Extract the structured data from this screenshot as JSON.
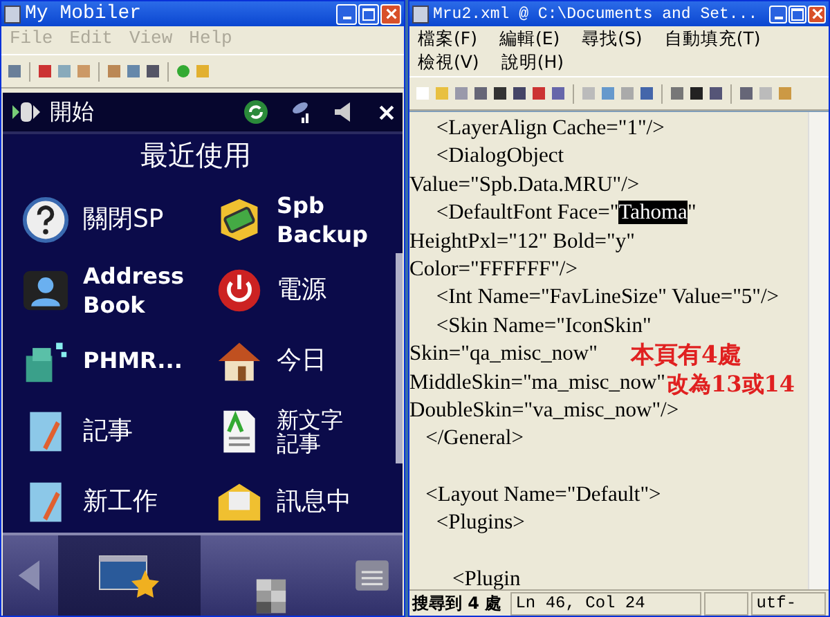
{
  "left_window": {
    "title": "My Mobiler",
    "menu": [
      "File",
      "Edit",
      "View",
      "Help"
    ],
    "device": {
      "start_label": "開始",
      "section_title": "最近使用",
      "apps": [
        {
          "label": "關閉SP",
          "kind": "help"
        },
        {
          "label": "Spb Backup",
          "kind": "backup"
        },
        {
          "label": "Address Book",
          "kind": "contact"
        },
        {
          "label": "電源",
          "kind": "power"
        },
        {
          "label": "PHMR...",
          "kind": "registry"
        },
        {
          "label": "今日",
          "kind": "home"
        },
        {
          "label": "記事",
          "kind": "notes"
        },
        {
          "label": "新文字記事",
          "kind": "document"
        },
        {
          "label": "新工作",
          "kind": "task"
        },
        {
          "label": "訊息中",
          "kind": "message"
        }
      ],
      "nav": [
        {
          "kind": "back",
          "selected": false
        },
        {
          "kind": "favorites",
          "selected": true
        },
        {
          "kind": "grid",
          "selected": false
        },
        {
          "kind": "menu",
          "selected": false
        }
      ]
    }
  },
  "right_window": {
    "title": "Mru2.xml @ C:\\Documents and Set...",
    "menu": [
      "檔案(F)",
      "編輯(E)",
      "尋找(S)",
      "自動填充(T)",
      "檢視(V)",
      "說明(H)"
    ],
    "lines": [
      {
        "segments": [
          {
            "text": "     <LayerAlign Cache=\"1\"/>",
            "selected": false
          }
        ]
      },
      {
        "segments": [
          {
            "text": "     <DialogObject",
            "selected": false
          }
        ]
      },
      {
        "segments": [
          {
            "text": "Value=\"Spb.Data.MRU\"/>",
            "selected": false
          }
        ]
      },
      {
        "segments": [
          {
            "text": "     <DefaultFont Face=\"",
            "selected": false
          },
          {
            "text": "Tahoma",
            "selected": true
          },
          {
            "text": "\"",
            "selected": false
          }
        ]
      },
      {
        "segments": [
          {
            "text": "HeightPxl=\"12\" Bold=\"y\"",
            "selected": false
          }
        ]
      },
      {
        "segments": [
          {
            "text": "Color=\"FFFFFF\"/>",
            "selected": false
          }
        ]
      },
      {
        "segments": [
          {
            "text": "     <Int Name=\"FavLineSize\" Value=\"5\"/>",
            "selected": false
          }
        ]
      },
      {
        "segments": [
          {
            "text": "     <Skin Name=\"IconSkin\"",
            "selected": false
          }
        ]
      },
      {
        "segments": [
          {
            "text": "Skin=\"qa_misc_now\"",
            "selected": false
          }
        ]
      },
      {
        "segments": [
          {
            "text": "MiddleSkin=\"ma_misc_now\"",
            "selected": false
          }
        ]
      },
      {
        "segments": [
          {
            "text": "DoubleSkin=\"va_misc_now\"/>",
            "selected": false
          }
        ]
      },
      {
        "segments": [
          {
            "text": "   </General>",
            "selected": false
          }
        ]
      },
      {
        "space_before": true,
        "segments": [
          {
            "text": "   <Layout Name=\"Default\">",
            "selected": false
          }
        ]
      },
      {
        "segments": [
          {
            "text": "     <Plugins>",
            "selected": false
          }
        ]
      },
      {
        "space_before": true,
        "segments": [
          {
            "text": "        <Plugin",
            "selected": false
          }
        ]
      }
    ],
    "annotation": [
      "本頁有4處",
      "改為13或14"
    ],
    "status_bar": [
      "搜尋到 4 處",
      "Ln 46, Col 24",
      "utf-"
    ]
  }
}
